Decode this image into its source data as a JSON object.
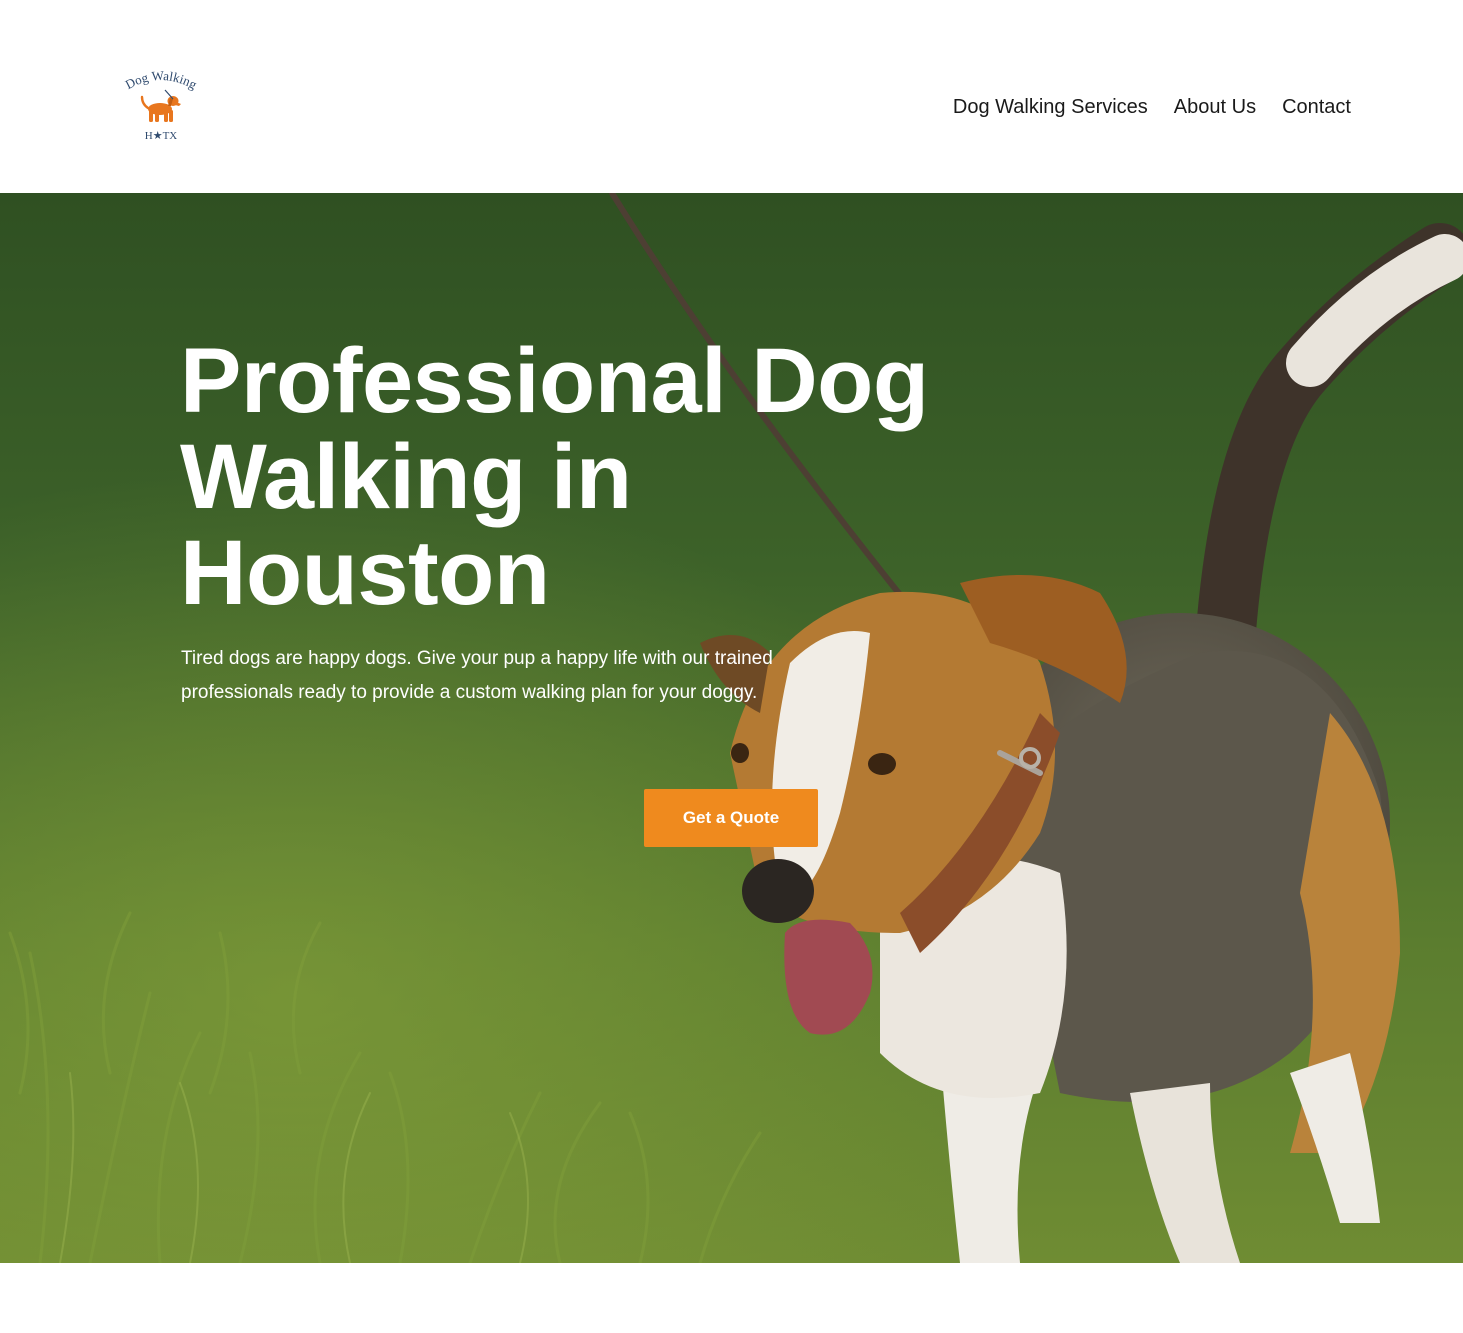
{
  "brand": {
    "logo_top_text": "Dog Walking",
    "logo_bottom_text": "H★TX",
    "logo_icon": "dog-icon",
    "logo_dog_color": "#e8761e",
    "logo_text_color": "#2f4a6e"
  },
  "nav": {
    "items": [
      {
        "label": "Dog Walking Services"
      },
      {
        "label": "About Us"
      },
      {
        "label": "Contact"
      }
    ]
  },
  "hero": {
    "title": "Professional Dog Walking in Houston",
    "subtitle": "Tired dogs are happy dogs. Give your pup a happy life with our trained professionals ready to provide a custom walking plan for your doggy.",
    "cta_label": "Get a Quote",
    "cta_color": "#ef8a1e",
    "background_image": "beagle-on-leash-in-grass"
  }
}
